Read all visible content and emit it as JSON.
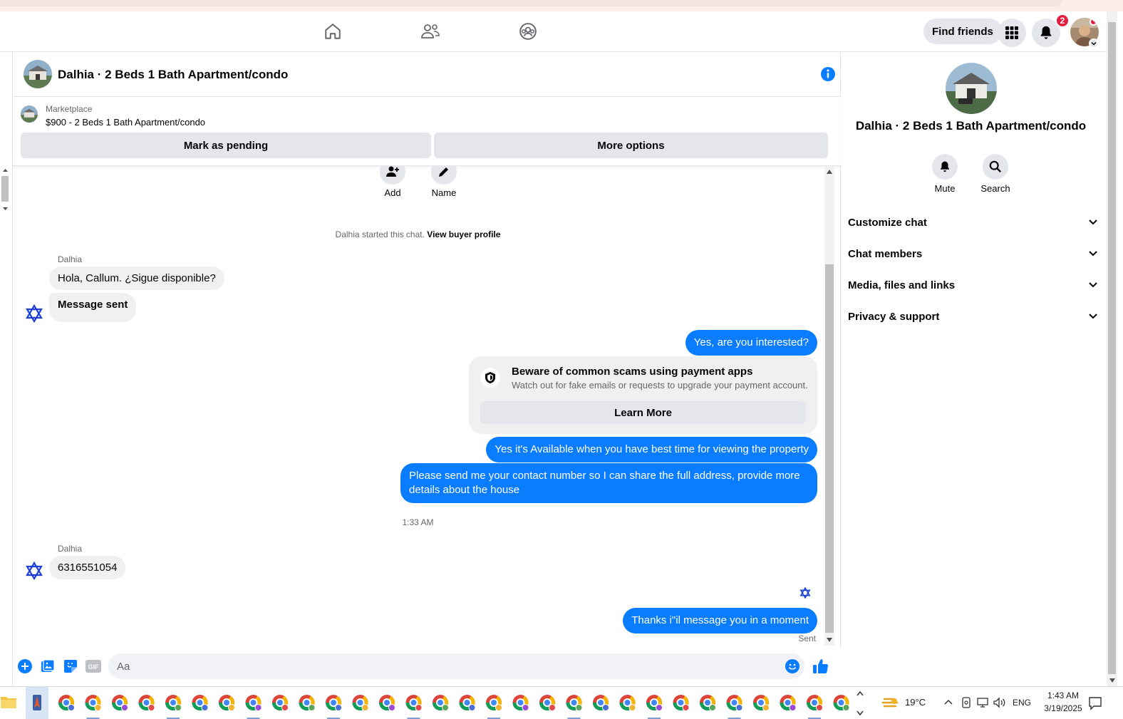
{
  "topnav": {
    "find_friends_label": "Find friends",
    "notification_count": "2"
  },
  "chat": {
    "title": "Dalhia · 2 Beds 1 Bath Apartment/condo",
    "marketplace": {
      "label": "Marketplace",
      "item": "$900 - 2 Beds 1 Bath Apartment/condo",
      "mark_pending_label": "Mark as pending",
      "more_options_label": "More options"
    },
    "actions": [
      {
        "label": "Add",
        "icon": "add-person-icon"
      },
      {
        "label": "Name",
        "icon": "pencil-icon"
      }
    ],
    "system_text": "Dalhia started this chat.",
    "view_buyer_profile": "View buyer profile",
    "sender_name": "Dalhia",
    "messages": {
      "in_1": "Hola, Callum. ¿Sigue disponible?",
      "in_2": "Message sent",
      "out_1": "Yes, are you interested?",
      "scam_title": "Beware of common scams using payment apps",
      "scam_sub": "Watch out for fake emails or requests to upgrade your payment account.",
      "learn_more": "Learn More",
      "out_2": "Yes it's Available when you have best time for viewing the property",
      "out_3": "Please send me your contact number so I can share the full address, provide more details about the house",
      "timestamp": "1:33 AM",
      "in_3": "6316551054",
      "out_4": "Thanks i\"il message you in a moment",
      "status": "Sent"
    },
    "composer_placeholder": "Aa",
    "composer_gif": "GIF"
  },
  "side": {
    "title": "Dalhia · 2 Beds 1 Bath Apartment/condo",
    "mute_label": "Mute",
    "search_label": "Search",
    "sections": [
      "Customize chat",
      "Chat members",
      "Media, files and links",
      "Privacy & support"
    ]
  },
  "taskbar": {
    "temperature": "19°C",
    "language": "ENG",
    "time": "1:43 AM",
    "date": "3/19/2025"
  },
  "colors": {
    "accent": "#0a7cff",
    "bubble_in": "#f0f0f0",
    "button_bg": "#e4e6eb",
    "badge": "#e41e3f"
  }
}
